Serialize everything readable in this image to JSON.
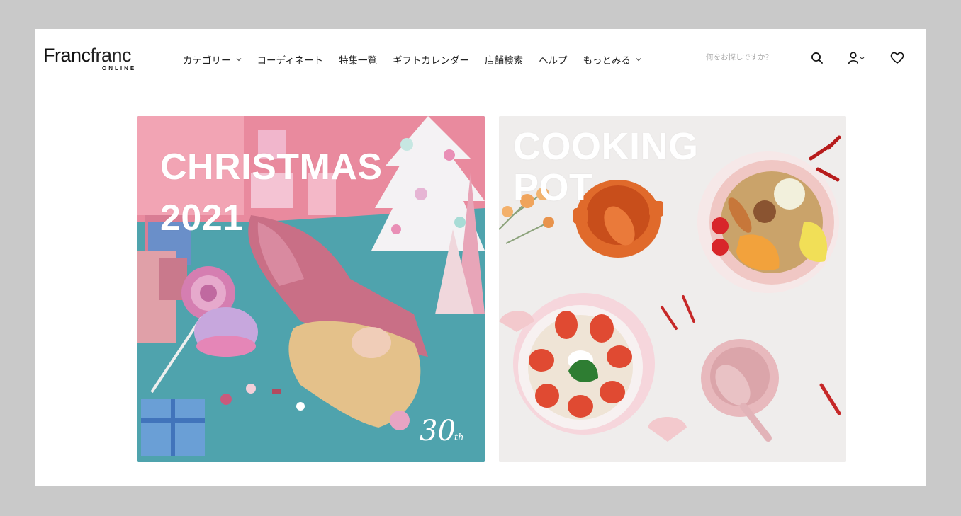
{
  "header": {
    "logo_main_bold": "Franc",
    "logo_main_light": "franc",
    "logo_sub": "ONLINE",
    "nav": [
      {
        "label": "カテゴリー",
        "has_dropdown": true
      },
      {
        "label": "コーディネート",
        "has_dropdown": false
      },
      {
        "label": "特集一覧",
        "has_dropdown": false
      },
      {
        "label": "ギフトカレンダー",
        "has_dropdown": false
      },
      {
        "label": "店舗検索",
        "has_dropdown": false
      },
      {
        "label": "ヘルプ",
        "has_dropdown": false
      },
      {
        "label": "もっとみる",
        "has_dropdown": true
      }
    ],
    "search_placeholder": "何をお探しですか？",
    "icons": [
      "search-icon",
      "user-icon",
      "heart-icon"
    ]
  },
  "banners": [
    {
      "name": "christmas",
      "title_lines": [
        "CHRISTMAS",
        "2021"
      ],
      "badge": "30",
      "badge_suffix": "th"
    },
    {
      "name": "cooking-pot",
      "title_lines": [
        "COOKING",
        "POT"
      ]
    }
  ],
  "colors": {
    "page_bg": "#c9c9c9",
    "panel_bg": "#ffffff",
    "christmas_floor": "#4fa3ad",
    "christmas_wall": "#e98a9e",
    "cooking_table": "#efedec"
  }
}
